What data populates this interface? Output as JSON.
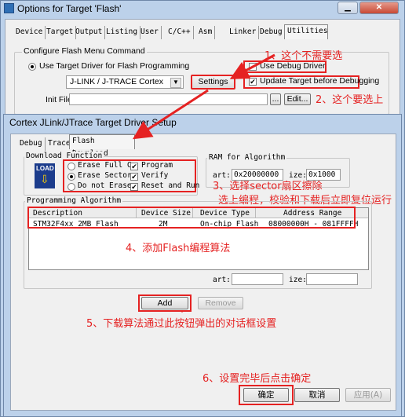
{
  "back_window": {
    "title": "Options for Target 'Flash'",
    "tabs": [
      "Device",
      "Target",
      "Output",
      "Listing",
      "User",
      "C/C++",
      "Asm",
      "Linker",
      "Debug",
      "Utilities"
    ],
    "active_tab": "Utilities",
    "group_title": "Configure Flash Menu Command",
    "use_target_driver_label": "Use Target Driver for Flash Programming",
    "driver_value": "J-LINK / J-TRACE Cortex",
    "settings_label": "Settings",
    "use_debug_driver_label": "Use Debug Driver",
    "update_target_label": "Update Target before Debugging",
    "init_file_label": "Init File:",
    "browse_label": "...",
    "edit_label": "Edit..."
  },
  "front_window": {
    "title": "Cortex JLink/JTrace Target Driver Setup",
    "tabs": [
      "Debug",
      "Trace",
      "Flash Download"
    ],
    "active_tab": "Flash Download",
    "download_function": {
      "title": "Download Function",
      "load_icon_text": "LOAD",
      "erase_full": "Erase Full C",
      "erase_sectors": "Erase Sector",
      "no_erase": "Do not Erase",
      "program": "Program",
      "verify": "Verify",
      "reset_run": "Reset and Run"
    },
    "ram": {
      "title": "RAM for Algorithm",
      "start_label": "art:",
      "start_value": "0x20000000",
      "size_label": "ize:",
      "size_value": "0x1000"
    },
    "programming_algorithm": {
      "title": "Programming Algorithm",
      "columns": [
        "Description",
        "Device Size",
        "Device Type",
        "Address Range"
      ],
      "rows": [
        {
          "description": "STM32F4xx 2MB Flash",
          "size": "2M",
          "type": "On-chip Flash",
          "range": "08000000H - 081FFFFH"
        }
      ],
      "start_label": "art:",
      "size_label": "ize:"
    },
    "add_label": "Add",
    "remove_label": "Remove",
    "ok_label": "确定",
    "cancel_label": "取消",
    "apply_label": "应用(A)"
  },
  "annotations": {
    "a1": "1、这个不需要选",
    "a2": "2、这个要选上",
    "a3": "3、选择sector扇区擦除",
    "a3b": "选上编程，校验和下载后立即复位运行",
    "a4": "4、添加Flash编程算法",
    "a5": "5、下载算法通过此按钮弹出的对话框设置",
    "a6": "6、设置完毕后点击确定"
  },
  "colors": {
    "accent_red": "#e52222",
    "title_bar": "#bcd1ea"
  }
}
